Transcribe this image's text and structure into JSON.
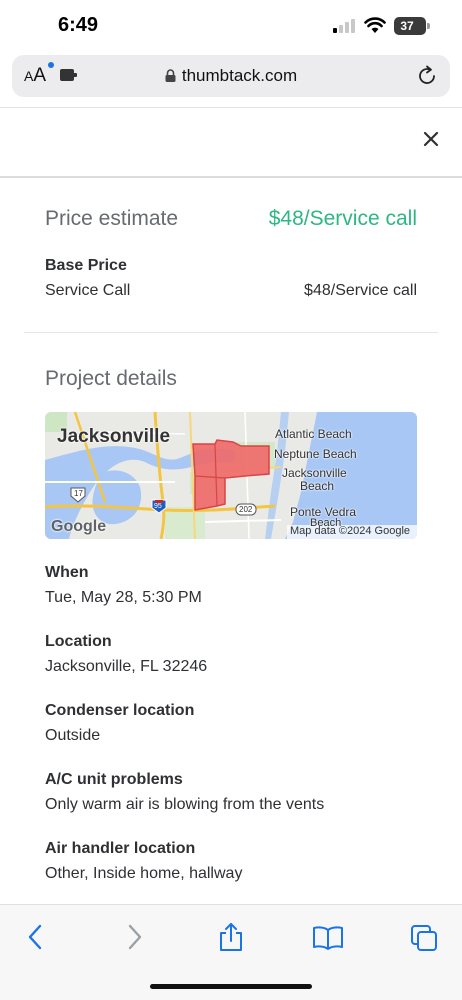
{
  "status_bar": {
    "time": "6:49",
    "battery": "37"
  },
  "browser": {
    "text_size_small": "A",
    "text_size_large": "A",
    "url": "thumbtack.com"
  },
  "price": {
    "label": "Price estimate",
    "value": "$48/Service call",
    "accent_color": "#2db783",
    "base_title": "Base Price",
    "base_name": "Service Call",
    "base_value": "$48/Service call"
  },
  "project": {
    "title": "Project details",
    "map": {
      "labels": {
        "jacksonville": "Jacksonville",
        "atlantic_beach": "Atlantic Beach",
        "neptune_beach": "Neptune Beach",
        "jacksonville_beach_1": "Jacksonville",
        "jacksonville_beach_2": "Beach",
        "ponte_vedra_1": "Ponte Vedra",
        "ponte_vedra_2": "Beach",
        "route_17": "17",
        "route_95": "95",
        "route_202": "202",
        "google": "Google",
        "attribution": "Map data ©2024 Google"
      }
    },
    "details": [
      {
        "title": "When",
        "value": "Tue, May 28, 5:30 PM"
      },
      {
        "title": "Location",
        "value": "Jacksonville, FL 32246"
      },
      {
        "title": "Condenser location",
        "value": "Outside"
      },
      {
        "title": "A/C unit problems",
        "value": "Only warm air is blowing from the vents"
      },
      {
        "title": "Air handler location",
        "value": "Other, Inside home, hallway"
      }
    ]
  },
  "toolbar": {
    "icons": [
      "back-icon",
      "forward-icon",
      "share-icon",
      "bookmarks-icon",
      "tabs-icon"
    ],
    "accent_color": "#1a73e8"
  }
}
